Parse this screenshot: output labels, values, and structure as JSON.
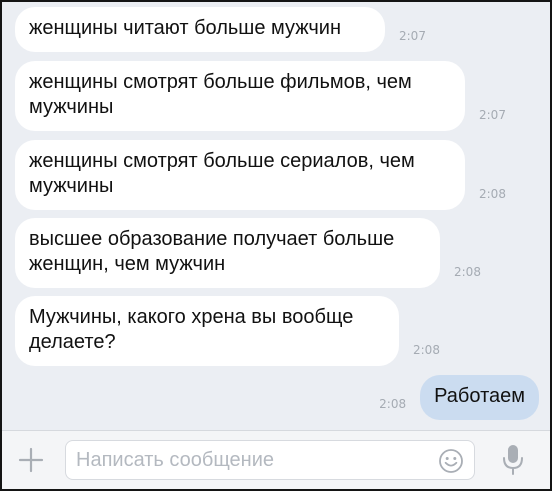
{
  "messages": [
    {
      "text_lines": [
        "женщины читают больше мужчин"
      ],
      "time": "2:07",
      "direction": "incoming"
    },
    {
      "text_lines": [
        "женщины смотрят больше фильмов, чем",
        "мужчины"
      ],
      "time": "2:07",
      "direction": "incoming"
    },
    {
      "text_lines": [
        "женщины смотрят больше сериалов, чем",
        "мужчины"
      ],
      "time": "2:08",
      "direction": "incoming"
    },
    {
      "text_lines": [
        "высшее образование получает больше",
        "женщин, чем мужчин"
      ],
      "time": "2:08",
      "direction": "incoming"
    },
    {
      "text_lines": [
        "Мужчины, какого хрена вы вообще",
        "делаете?"
      ],
      "time": "2:08",
      "direction": "incoming"
    },
    {
      "text_lines": [
        "Работаем"
      ],
      "time": "2:08",
      "direction": "outgoing"
    }
  ],
  "composer": {
    "placeholder": "Написать сообщение",
    "value": ""
  },
  "icons": {
    "attach": "plus-icon",
    "emoji": "smiley-icon",
    "voice": "microphone-icon"
  },
  "colors": {
    "chat_background": "#ebeef3",
    "incoming_bubble": "#ffffff",
    "outgoing_bubble": "#cbdcf0",
    "timestamp": "#a5abb3",
    "icon_gray": "#a9aeb5",
    "composer_background": "#f4f5f7"
  }
}
